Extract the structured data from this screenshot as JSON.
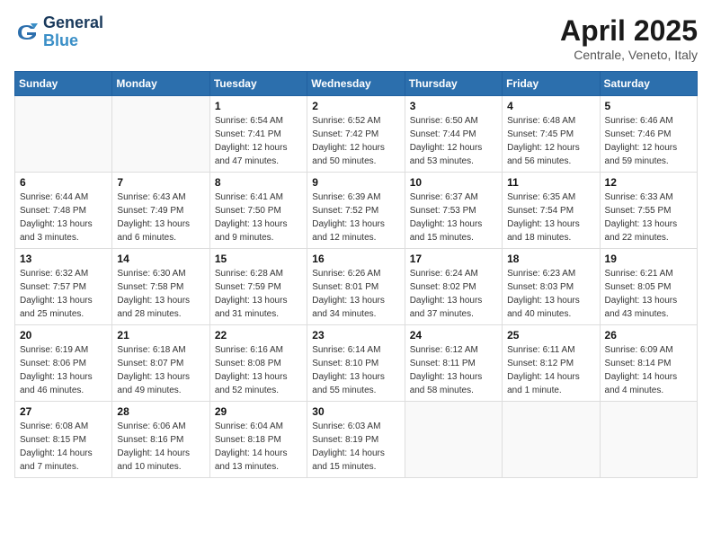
{
  "header": {
    "logo_line1": "General",
    "logo_line2": "Blue",
    "month_title": "April 2025",
    "subtitle": "Centrale, Veneto, Italy"
  },
  "days_of_week": [
    "Sunday",
    "Monday",
    "Tuesday",
    "Wednesday",
    "Thursday",
    "Friday",
    "Saturday"
  ],
  "weeks": [
    [
      {
        "day": "",
        "info": ""
      },
      {
        "day": "",
        "info": ""
      },
      {
        "day": "1",
        "info": "Sunrise: 6:54 AM\nSunset: 7:41 PM\nDaylight: 12 hours and 47 minutes."
      },
      {
        "day": "2",
        "info": "Sunrise: 6:52 AM\nSunset: 7:42 PM\nDaylight: 12 hours and 50 minutes."
      },
      {
        "day": "3",
        "info": "Sunrise: 6:50 AM\nSunset: 7:44 PM\nDaylight: 12 hours and 53 minutes."
      },
      {
        "day": "4",
        "info": "Sunrise: 6:48 AM\nSunset: 7:45 PM\nDaylight: 12 hours and 56 minutes."
      },
      {
        "day": "5",
        "info": "Sunrise: 6:46 AM\nSunset: 7:46 PM\nDaylight: 12 hours and 59 minutes."
      }
    ],
    [
      {
        "day": "6",
        "info": "Sunrise: 6:44 AM\nSunset: 7:48 PM\nDaylight: 13 hours and 3 minutes."
      },
      {
        "day": "7",
        "info": "Sunrise: 6:43 AM\nSunset: 7:49 PM\nDaylight: 13 hours and 6 minutes."
      },
      {
        "day": "8",
        "info": "Sunrise: 6:41 AM\nSunset: 7:50 PM\nDaylight: 13 hours and 9 minutes."
      },
      {
        "day": "9",
        "info": "Sunrise: 6:39 AM\nSunset: 7:52 PM\nDaylight: 13 hours and 12 minutes."
      },
      {
        "day": "10",
        "info": "Sunrise: 6:37 AM\nSunset: 7:53 PM\nDaylight: 13 hours and 15 minutes."
      },
      {
        "day": "11",
        "info": "Sunrise: 6:35 AM\nSunset: 7:54 PM\nDaylight: 13 hours and 18 minutes."
      },
      {
        "day": "12",
        "info": "Sunrise: 6:33 AM\nSunset: 7:55 PM\nDaylight: 13 hours and 22 minutes."
      }
    ],
    [
      {
        "day": "13",
        "info": "Sunrise: 6:32 AM\nSunset: 7:57 PM\nDaylight: 13 hours and 25 minutes."
      },
      {
        "day": "14",
        "info": "Sunrise: 6:30 AM\nSunset: 7:58 PM\nDaylight: 13 hours and 28 minutes."
      },
      {
        "day": "15",
        "info": "Sunrise: 6:28 AM\nSunset: 7:59 PM\nDaylight: 13 hours and 31 minutes."
      },
      {
        "day": "16",
        "info": "Sunrise: 6:26 AM\nSunset: 8:01 PM\nDaylight: 13 hours and 34 minutes."
      },
      {
        "day": "17",
        "info": "Sunrise: 6:24 AM\nSunset: 8:02 PM\nDaylight: 13 hours and 37 minutes."
      },
      {
        "day": "18",
        "info": "Sunrise: 6:23 AM\nSunset: 8:03 PM\nDaylight: 13 hours and 40 minutes."
      },
      {
        "day": "19",
        "info": "Sunrise: 6:21 AM\nSunset: 8:05 PM\nDaylight: 13 hours and 43 minutes."
      }
    ],
    [
      {
        "day": "20",
        "info": "Sunrise: 6:19 AM\nSunset: 8:06 PM\nDaylight: 13 hours and 46 minutes."
      },
      {
        "day": "21",
        "info": "Sunrise: 6:18 AM\nSunset: 8:07 PM\nDaylight: 13 hours and 49 minutes."
      },
      {
        "day": "22",
        "info": "Sunrise: 6:16 AM\nSunset: 8:08 PM\nDaylight: 13 hours and 52 minutes."
      },
      {
        "day": "23",
        "info": "Sunrise: 6:14 AM\nSunset: 8:10 PM\nDaylight: 13 hours and 55 minutes."
      },
      {
        "day": "24",
        "info": "Sunrise: 6:12 AM\nSunset: 8:11 PM\nDaylight: 13 hours and 58 minutes."
      },
      {
        "day": "25",
        "info": "Sunrise: 6:11 AM\nSunset: 8:12 PM\nDaylight: 14 hours and 1 minute."
      },
      {
        "day": "26",
        "info": "Sunrise: 6:09 AM\nSunset: 8:14 PM\nDaylight: 14 hours and 4 minutes."
      }
    ],
    [
      {
        "day": "27",
        "info": "Sunrise: 6:08 AM\nSunset: 8:15 PM\nDaylight: 14 hours and 7 minutes."
      },
      {
        "day": "28",
        "info": "Sunrise: 6:06 AM\nSunset: 8:16 PM\nDaylight: 14 hours and 10 minutes."
      },
      {
        "day": "29",
        "info": "Sunrise: 6:04 AM\nSunset: 8:18 PM\nDaylight: 14 hours and 13 minutes."
      },
      {
        "day": "30",
        "info": "Sunrise: 6:03 AM\nSunset: 8:19 PM\nDaylight: 14 hours and 15 minutes."
      },
      {
        "day": "",
        "info": ""
      },
      {
        "day": "",
        "info": ""
      },
      {
        "day": "",
        "info": ""
      }
    ]
  ]
}
